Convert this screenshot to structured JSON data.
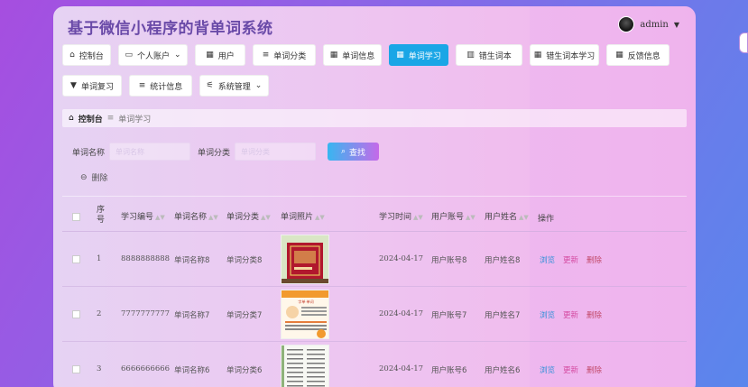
{
  "app": {
    "title": "基于微信小程序的背单词系统",
    "user": "admin"
  },
  "nav": [
    {
      "label": "控制台",
      "icon": "home-icon",
      "glyph": "⌂"
    },
    {
      "label": "个人账户",
      "icon": "wallet-icon",
      "glyph": "▭",
      "dropdown": "⌄"
    },
    {
      "label": "用户",
      "icon": "grid-icon",
      "glyph": "▦"
    },
    {
      "label": "单词分类",
      "icon": "list-icon",
      "glyph": "≡"
    },
    {
      "label": "单词信息",
      "icon": "grid-icon",
      "glyph": "▦"
    },
    {
      "label": "单词学习",
      "icon": "grid-icon",
      "glyph": "▦",
      "active": true
    },
    {
      "label": "错生词本",
      "icon": "bar-chart-icon",
      "glyph": "▥"
    },
    {
      "label": "错生词本学习",
      "icon": "grid-icon",
      "glyph": "▦"
    },
    {
      "label": "反馈信息",
      "icon": "grid-icon",
      "glyph": "▦"
    },
    {
      "label": "单词复习",
      "icon": "pin-icon",
      "glyph": "▼"
    },
    {
      "label": "统计信息",
      "icon": "list-icon",
      "glyph": "≡"
    },
    {
      "label": "系统管理",
      "icon": "sliders-icon",
      "glyph": "⚟",
      "dropdown": "⌄"
    }
  ],
  "breadcrumb": {
    "home": "控制台",
    "separator": "≡",
    "current": "单词学习"
  },
  "search": {
    "word_name_label": "单词名称",
    "word_name_placeholder": "单词名称",
    "word_cat_label": "单词分类",
    "word_cat_placeholder": "单词分类",
    "button": "查找"
  },
  "delete_label": "删除",
  "table": {
    "headers": [
      "序号",
      "学习编号",
      "单词名称",
      "单词分类",
      "单词照片",
      "学习时间",
      "用户账号",
      "用户姓名",
      "操作"
    ],
    "rows": [
      {
        "index": "1",
        "study_no": "8888888888",
        "word": "单词名称8",
        "category": "单词分类8",
        "time": "2024-04-17",
        "account": "用户账号8",
        "name": "用户姓名8"
      },
      {
        "index": "2",
        "study_no": "7777777777",
        "word": "单词名称7",
        "category": "单词分类7",
        "time": "2024-04-17",
        "account": "用户账号7",
        "name": "用户姓名7"
      },
      {
        "index": "3",
        "study_no": "6666666666",
        "word": "单词名称6",
        "category": "单词分类6",
        "time": "2024-04-17",
        "account": "用户账号6",
        "name": "用户姓名6"
      }
    ],
    "actions": {
      "view": "浏览",
      "edit": "更新",
      "delete": "删除"
    }
  },
  "thumb_text": "字单·单词"
}
